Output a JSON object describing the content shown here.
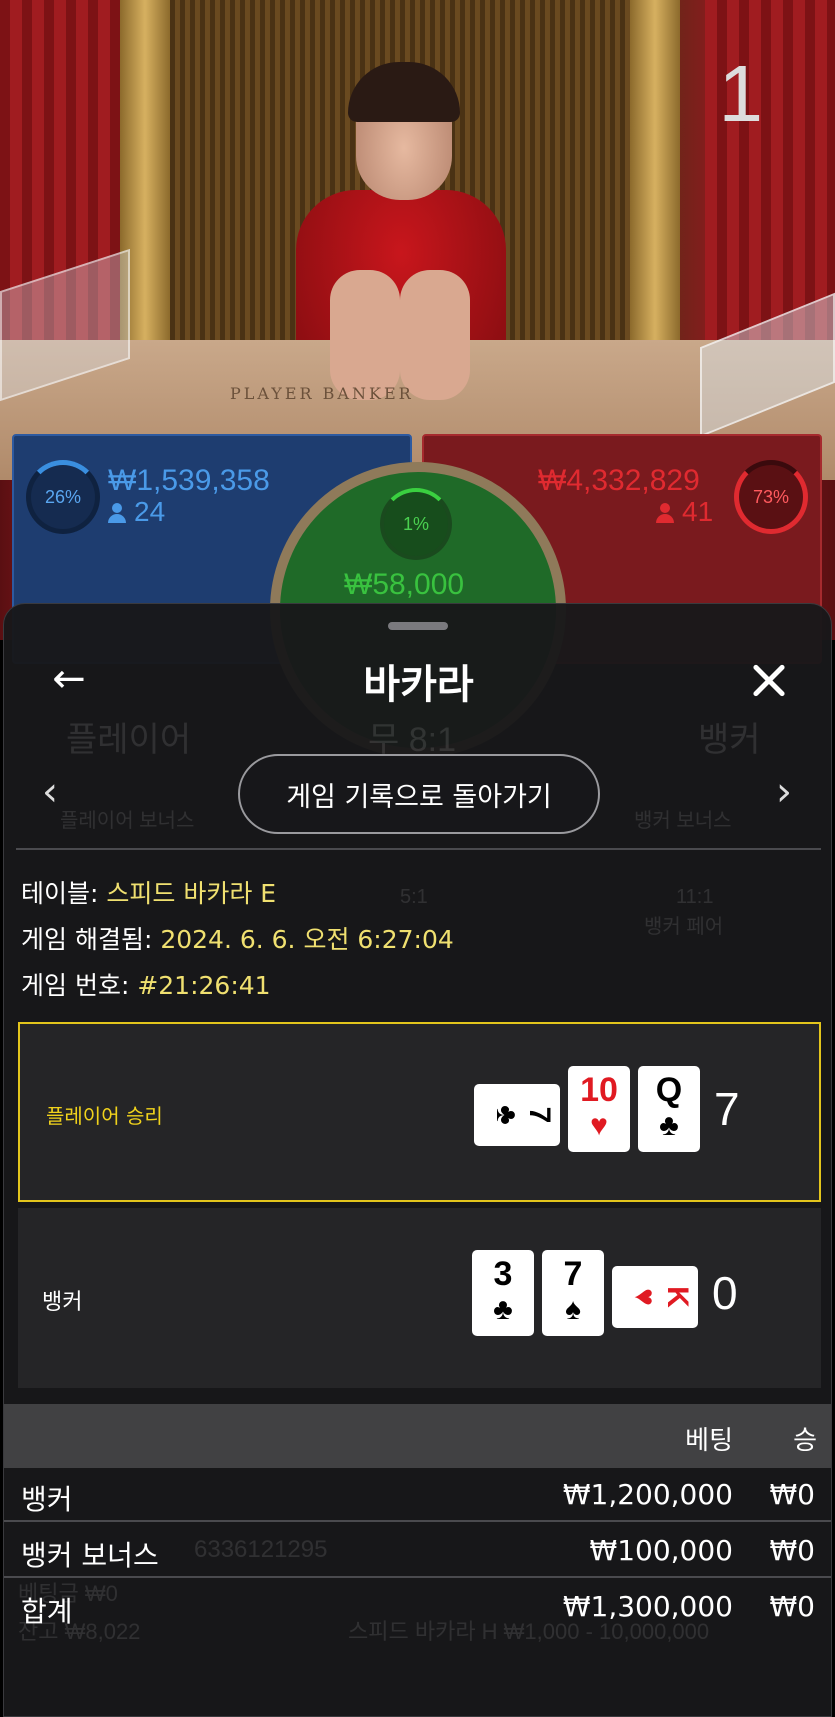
{
  "video": {
    "round_number": "1",
    "table_text": "PLAYER         BANKER"
  },
  "betting": {
    "player": {
      "percent": "26%",
      "amount": "₩1,539,358",
      "players": "24"
    },
    "banker": {
      "percent": "73%",
      "amount": "₩4,332,829",
      "players": "41"
    },
    "tie": {
      "percent": "1%",
      "amount": "₩58,000"
    }
  },
  "sheet": {
    "title": "바카라",
    "back_icon": "back-arrow-icon",
    "close_icon": "close-icon",
    "history_button": "게임 기록으로 돌아가기",
    "info": {
      "table_label": "테이블: ",
      "table_value": "스피드 바카라 E",
      "resolved_label": "게임 해결됨: ",
      "resolved_value": "2024. 6. 6. 오전 6:27:04",
      "number_label": "게임 번호: ",
      "number_value": "#21:26:41"
    },
    "hands": {
      "player": {
        "result": "플레이어 승리",
        "score": "7",
        "cards": [
          {
            "rank": "7",
            "suit": "♣",
            "color": "black",
            "sideways": true
          },
          {
            "rank": "10",
            "suit": "♥",
            "color": "red",
            "sideways": false
          },
          {
            "rank": "Q",
            "suit": "♣",
            "color": "black",
            "sideways": false
          }
        ]
      },
      "banker": {
        "result": "뱅커",
        "score": "0",
        "cards": [
          {
            "rank": "3",
            "suit": "♣",
            "color": "black",
            "sideways": false
          },
          {
            "rank": "7",
            "suit": "♠",
            "color": "black",
            "sideways": false
          },
          {
            "rank": "K",
            "suit": "♥",
            "color": "red",
            "sideways": true
          }
        ]
      }
    },
    "table": {
      "col_bet": "베팅",
      "col_win": "승",
      "rows": [
        {
          "name": "뱅커",
          "bet": "₩1,200,000",
          "win": "₩0"
        },
        {
          "name": "뱅커 보너스",
          "bet": "₩100,000",
          "win": "₩0"
        },
        {
          "name": "합계",
          "bet": "₩1,300,000",
          "win": "₩0"
        }
      ]
    }
  },
  "background_ui": {
    "player_label": "플레이어",
    "tie_label": "무 8:1",
    "banker_label": "뱅커",
    "player_bonus": "플레이어 보너스",
    "banker_bonus": "뱅커 보너스",
    "pair_odds": "11:1",
    "banker_pair": "뱅커 페어",
    "tie_odds": "5:1",
    "balance_label": "잔고 ₩8,022",
    "bet_label": "베팅금 ₩0",
    "game_id": "6336121295",
    "limits": "스피드 바카라 H  ₩1,000 - 10,000,000"
  },
  "colors": {
    "player_blue": "#4a9ae8",
    "banker_red": "#e02a30",
    "tie_green": "#39c23f",
    "highlight_yellow": "#e3c51c",
    "info_value": "#f0e070"
  }
}
